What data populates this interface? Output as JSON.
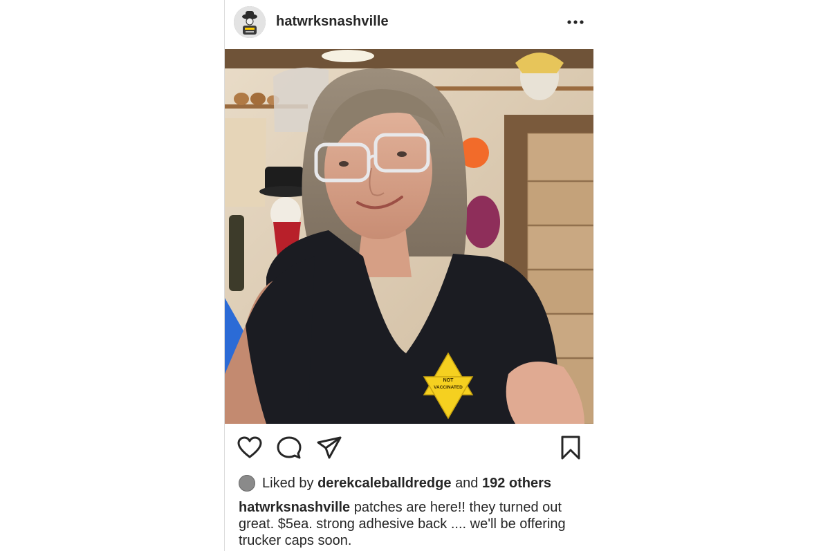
{
  "post": {
    "username": "hatwrksnashville",
    "more_icon": "more-horizontal-icon",
    "photo": {
      "patch_text_line1": "NOT",
      "patch_text_line2": "VACCINATED",
      "patch_color": "#f5d020"
    },
    "actions": {
      "like_icon": "heart-icon",
      "comment_icon": "comment-icon",
      "share_icon": "share-icon",
      "save_icon": "bookmark-icon"
    },
    "likes": {
      "prefix": "Liked by",
      "liker": "derekcaleballdredge",
      "conjunction": "and",
      "others": "192 others"
    },
    "caption": {
      "username": "hatwrksnashville",
      "text": "patches are here!! they turned out great. $5ea. strong adhesive back .... we'll be offering trucker caps soon."
    }
  }
}
